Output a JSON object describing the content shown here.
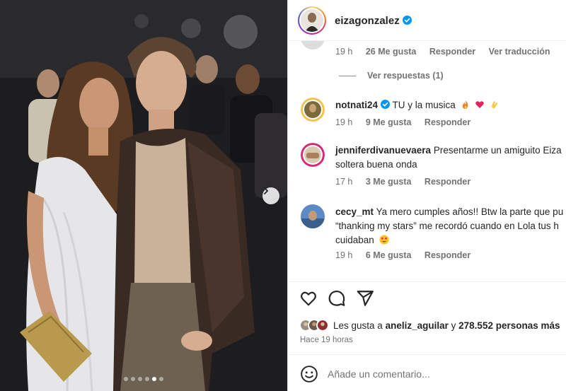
{
  "post": {
    "author": "eizagonzalez",
    "verified": true,
    "carousel": {
      "total": 6,
      "active_index": 4
    }
  },
  "comments": [
    {
      "username": "",
      "text": "",
      "time": "19 h",
      "likes": "26 Me gusta",
      "reply": "Responder",
      "translate": "Ver traducción",
      "view_replies": "Ver respuestas (1)"
    },
    {
      "username": "notnati24",
      "verified": true,
      "text": "TU y la musica",
      "emojis": [
        "fire-emoji",
        "red-heart-emoji",
        "clapping-hands-emoji"
      ],
      "time": "19 h",
      "likes": "9 Me gusta",
      "reply": "Responder"
    },
    {
      "username": "jenniferdivanuevaera",
      "text_line1": "Presentarme un amiguito Eiza",
      "text_line2": "soltera buena onda",
      "time": "17 h",
      "likes": "3 Me gusta",
      "reply": "Responder"
    },
    {
      "username": "cecy_mt",
      "text_line1": "Ya mero cumples años!! Btw la parte que pu",
      "text_line2": "“thanking my stars” me recordó cuando en Lola tus h",
      "text_line3": "cuidaban",
      "emojis": [
        "heart-eyes-emoji"
      ],
      "time": "19 h",
      "likes": "6 Me gusta",
      "reply": "Responder"
    }
  ],
  "likes": {
    "prefix": "Les gusta a",
    "user": "aneliz_aguilar",
    "joiner": "y",
    "count": "278.552 personas más"
  },
  "timestamp": "Hace 19 horas",
  "comment_box": {
    "placeholder": "Añade un comentario..."
  },
  "colors": {
    "verified": "#0095f6",
    "text": "#262626",
    "secondary": "#737373"
  }
}
